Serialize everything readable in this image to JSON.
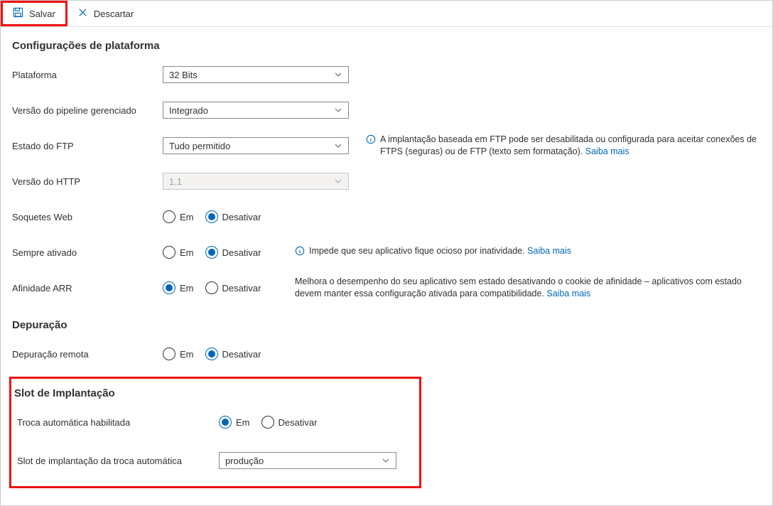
{
  "toolbar": {
    "save": "Salvar",
    "discard": "Descartar"
  },
  "sections": {
    "platform": "Configurações de plataforma",
    "debug": "Depuração",
    "slot": "Slot de Implantação"
  },
  "labels": {
    "platform": "Plataforma",
    "pipeline": "Versão do pipeline gerenciado",
    "ftp": "Estado do FTP",
    "http": "Versão do HTTP",
    "websockets": "Soquetes Web",
    "alwaysOn": "Sempre ativado",
    "arr": "Afinidade ARR",
    "remoteDebug": "Depuração remota",
    "autoSwap": "Troca automática habilitada",
    "autoSwapSlot": "Slot de implantação da troca automática"
  },
  "options": {
    "on": "Em",
    "off": "Desativar"
  },
  "values": {
    "platform": "32 Bits",
    "pipeline": "Integrado",
    "ftp": "Tudo permitido",
    "http": "1.1",
    "websockets": "off",
    "alwaysOn": "off",
    "arr": "on",
    "remoteDebug": "off",
    "autoSwap": "on",
    "autoSwapSlot": "produção"
  },
  "help": {
    "ftp_text": "A implantação baseada em FTP pode ser desabilitada ou configurada para aceitar conexões de FTPS (seguras) ou de FTP (texto sem formatação). ",
    "alwaysOn_text": "Impede que seu aplicativo fique ocioso por inatividade. ",
    "arr_text": "Melhora o desempenho do seu aplicativo sem estado desativando o cookie de afinidade – aplicativos com estado devem manter essa configuração ativada para compatibilidade. ",
    "learn_more": "Saiba mais"
  }
}
